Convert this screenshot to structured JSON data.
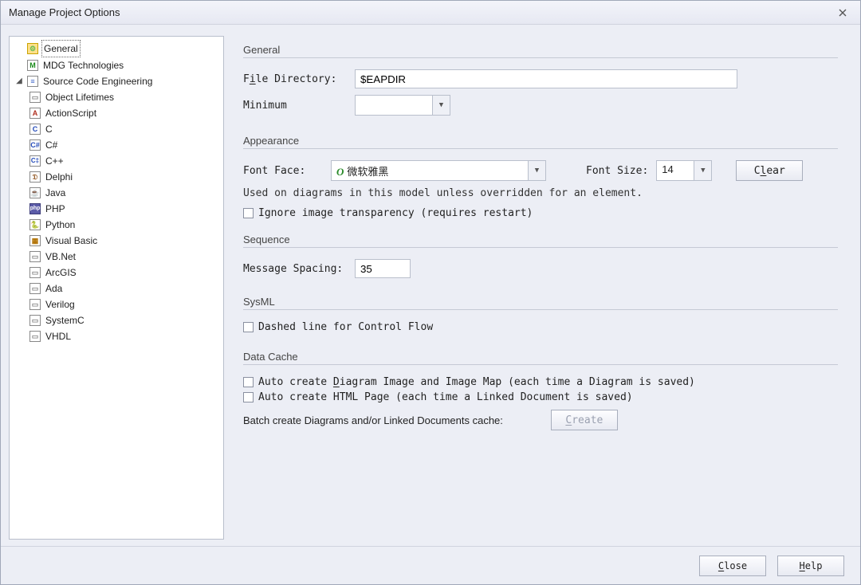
{
  "window": {
    "title": "Manage Project Options"
  },
  "tree": {
    "n0": "General",
    "n1": "MDG Technologies",
    "n2": "Source Code Engineering",
    "c": {
      "0": "Object Lifetimes",
      "1": "ActionScript",
      "2": "C",
      "3": "C#",
      "4": "C++",
      "5": "Delphi",
      "6": "Java",
      "7": "PHP",
      "8": "Python",
      "9": "Visual Basic",
      "10": "VB.Net",
      "11": "ArcGIS",
      "12": "Ada",
      "13": "Verilog",
      "14": "SystemC",
      "15": "VHDL"
    }
  },
  "form": {
    "sec_general": "General",
    "file_dir_label_pre": "F",
    "file_dir_label_u": "i",
    "file_dir_label_post": "le Directory:",
    "file_dir_value": "$EAPDIR",
    "minimum_label": "Minimum",
    "sec_appearance": "Appearance",
    "font_face_label": "Font Face:",
    "font_face_value": "微软雅黑",
    "font_size_label": "Font Size:",
    "font_size_value": "14",
    "clear_btn_pre": "C",
    "clear_btn_u": "l",
    "clear_btn_post": "ear",
    "appearance_note": "Used on diagrams in this model unless overridden for an element.",
    "ignore_trans": "Ignore image transparency (requires restart)",
    "sec_sequence": "Sequence",
    "msg_spacing_label": "Message Spacing:",
    "msg_spacing_value": "35",
    "sec_sysml": "SysML",
    "dashed_line": "Dashed line for Control Flow",
    "sec_datacache": "Data Cache",
    "auto_diagram_pre": "Auto create ",
    "auto_diagram_u": "D",
    "auto_diagram_post": "iagram Image and Image Map (each time a Diagram is saved)",
    "auto_html": "Auto create HTML Page (each time a Linked Document is saved)",
    "batch_label": "Batch create Diagrams and/or Linked Documents cache:",
    "create_btn_u": "C",
    "create_btn_post": "reate"
  },
  "footer": {
    "close_u": "C",
    "close_post": "lose",
    "help_u": "H",
    "help_post": "elp"
  }
}
